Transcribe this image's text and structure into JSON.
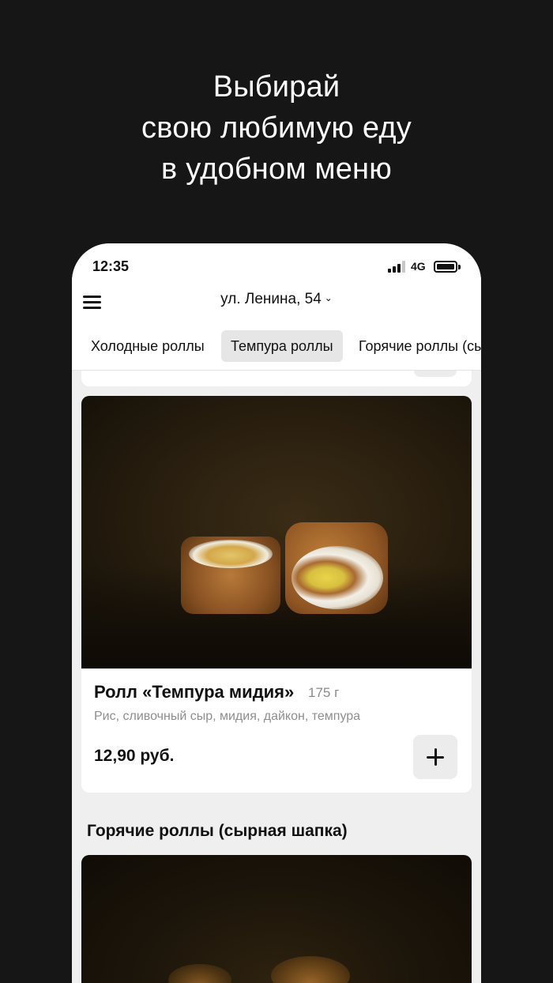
{
  "promo": {
    "line1": "Выбирай",
    "line2": "свою любимую еду",
    "line3": "в удобном меню"
  },
  "status_bar": {
    "time": "12:35",
    "network": "4G",
    "icons": [
      "signal-icon",
      "battery-icon"
    ]
  },
  "header": {
    "menu_icon": "hamburger-menu-icon",
    "address": "ул. Ленина, 54",
    "address_chevron": "⌄"
  },
  "tabs": [
    {
      "label": "Холодные роллы",
      "active": false
    },
    {
      "label": "Темпура роллы",
      "active": true
    },
    {
      "label": "Горячие роллы (сырная шапка)",
      "active": false
    }
  ],
  "product": {
    "title": "Ролл «Темпура мидия»",
    "weight": "175 г",
    "description": "Рис, сливочный сыр, мидия, дайкон, темпура",
    "price": "12,90 руб.",
    "add_icon": "plus-icon"
  },
  "section": {
    "title": "Горячие роллы (сырная шапка)"
  },
  "colors": {
    "background": "#161616",
    "phone_bg": "#efefef",
    "card_bg": "#ffffff",
    "active_tab": "#e6e6e6",
    "muted_text": "#8e8e8e"
  }
}
